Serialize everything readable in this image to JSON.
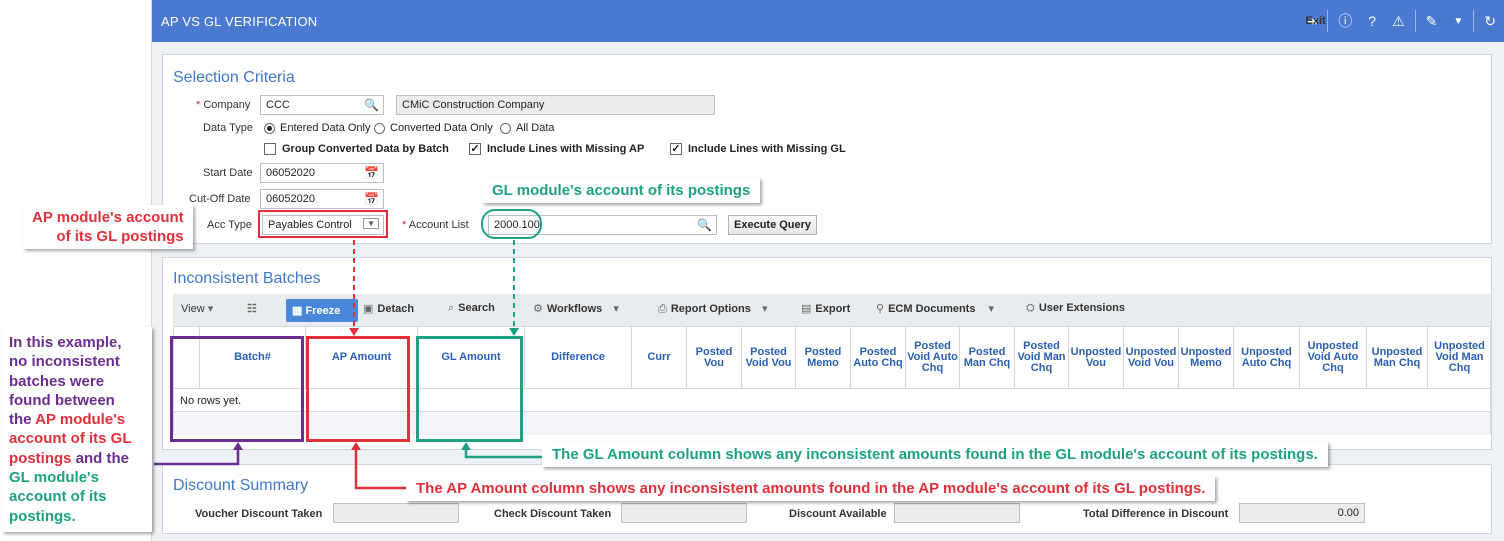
{
  "app": {
    "title": "AP VS GL VERIFICATION",
    "exit_label": "Exit"
  },
  "selection": {
    "title": "Selection Criteria",
    "company_label": "Company",
    "company_value": "CCC",
    "company_name": "CMiC Construction Company",
    "data_type_label": "Data Type",
    "data_type_options": [
      "Entered Data Only",
      "Converted Data Only",
      "All Data"
    ],
    "data_type_selected": "Entered Data Only",
    "group_converted_label": "Group Converted Data by Batch",
    "group_converted_checked": false,
    "missing_ap_label": "Include Lines with Missing AP",
    "missing_ap_checked": true,
    "missing_gl_label": "Include Lines with Missing GL",
    "missing_gl_checked": true,
    "start_date_label": "Start Date",
    "start_date_value": "06052020",
    "cutoff_date_label": "Cut-Off Date",
    "cutoff_date_value": "06052020",
    "acc_type_label": "Acc Type",
    "acc_type_value": "Payables Control",
    "account_list_label": "Account List",
    "account_list_value": "2000.100",
    "execute_label": "Execute Query"
  },
  "batches": {
    "title": "Inconsistent Batches",
    "toolbar": {
      "view": "View",
      "freeze": "Freeze",
      "detach": "Detach",
      "search": "Search",
      "workflows": "Workflows",
      "report_options": "Report Options",
      "export": "Export",
      "ecm_documents": "ECM Documents",
      "user_extensions": "User Extensions"
    },
    "columns": [
      "Batch#",
      "AP Amount",
      "GL Amount",
      "Difference",
      "Curr",
      "Posted Vou",
      "Posted Void Vou",
      "Posted Memo",
      "Posted Auto Chq",
      "Posted Void Auto Chq",
      "Posted Man Chq",
      "Posted Void Man Chq",
      "Unposted Vou",
      "Unposted Void Vou",
      "Unposted Memo",
      "Unposted Auto Chq",
      "Unposted Void Auto Chq",
      "Unposted Man Chq",
      "Unposted Void Man Chq"
    ],
    "empty_text": "No rows yet."
  },
  "discount": {
    "title": "Discount Summary",
    "voucher_label": "Voucher Discount Taken",
    "check_label": "Check Discount Taken",
    "available_label": "Discount Available",
    "total_label": "Total Difference in Discount",
    "total_value": "0.00"
  },
  "annotations": {
    "ap_module_line1": "AP module's account",
    "ap_module_line2": "of its GL postings",
    "gl_module": "GL module's account of its postings",
    "gl_amount_note": "The GL Amount column shows any inconsistent amounts found in the GL module's account of its postings.",
    "ap_amount_note": "The AP Amount column shows any inconsistent amounts found in the AP module's account of its GL postings.",
    "example_l1": "In this example,",
    "example_l2": "no inconsistent",
    "example_l3": "batches were",
    "example_l4": "found between",
    "example_l5": "the ",
    "example_l5b": "AP module's",
    "example_l6": "account of its GL",
    "example_l7": "postings",
    "example_l7b": " and the",
    "example_l8": "GL module's",
    "example_l9": "account of its",
    "example_l10": "postings."
  },
  "colors": {
    "titlebar": "#4a7ad0",
    "annotation_red": "#e0303a",
    "annotation_green": "#1ea283",
    "annotation_purple": "#6b2d8f"
  }
}
